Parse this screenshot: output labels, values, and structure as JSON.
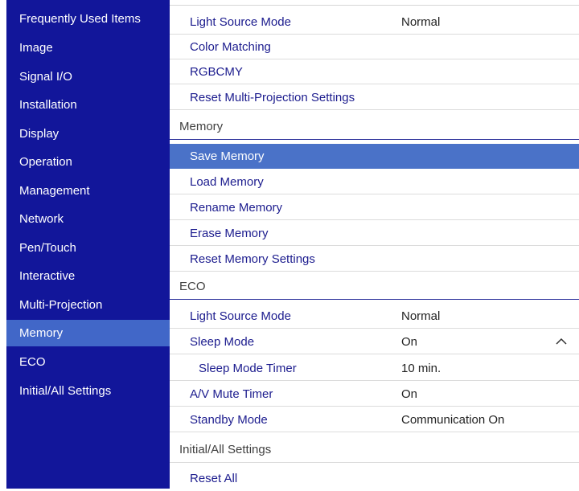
{
  "sidebar": {
    "items": [
      {
        "label": "Frequently Used Items"
      },
      {
        "label": "Image"
      },
      {
        "label": "Signal I/O"
      },
      {
        "label": "Installation"
      },
      {
        "label": "Display"
      },
      {
        "label": "Operation"
      },
      {
        "label": "Management"
      },
      {
        "label": "Network"
      },
      {
        "label": "Pen/Touch"
      },
      {
        "label": "Interactive"
      },
      {
        "label": "Multi-Projection"
      },
      {
        "label": "Memory",
        "active": true
      },
      {
        "label": "ECO"
      },
      {
        "label": "Initial/All Settings"
      }
    ]
  },
  "multi_projection": {
    "light_source_mode": {
      "label": "Light Source Mode",
      "value": "Normal"
    },
    "color_matching": {
      "label": "Color Matching"
    },
    "rgbcmy": {
      "label": "RGBCMY"
    },
    "reset": {
      "label": "Reset Multi-Projection Settings"
    }
  },
  "memory": {
    "header": "Memory",
    "save": {
      "label": "Save Memory",
      "selected": true
    },
    "load": {
      "label": "Load Memory"
    },
    "rename": {
      "label": "Rename Memory"
    },
    "erase": {
      "label": "Erase Memory"
    },
    "reset": {
      "label": "Reset Memory Settings"
    }
  },
  "eco": {
    "header": "ECO",
    "light_source_mode": {
      "label": "Light Source Mode",
      "value": "Normal"
    },
    "sleep_mode": {
      "label": "Sleep Mode",
      "value": "On"
    },
    "sleep_mode_timer": {
      "label": "Sleep Mode Timer",
      "value": "10 min."
    },
    "av_mute_timer": {
      "label": "A/V Mute Timer",
      "value": "On"
    },
    "standby_mode": {
      "label": "Standby Mode",
      "value": "Communication On"
    }
  },
  "initial_all": {
    "header": "Initial/All Settings",
    "reset_all": {
      "label": "Reset All"
    }
  },
  "colors": {
    "sidebar_bg": "#12169a",
    "sidebar_active": "#4167c8",
    "row_selected": "#4a72c8",
    "label_text": "#1c1c8e"
  },
  "icons": {
    "sleep_mode_expander": "chevron-up-icon"
  }
}
